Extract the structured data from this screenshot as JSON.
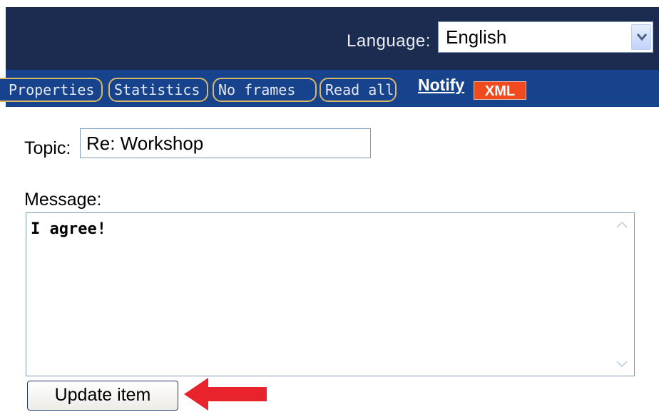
{
  "header": {
    "language_label": "Language:",
    "language_value": "English"
  },
  "nav": {
    "tabs": [
      {
        "label": "Properties"
      },
      {
        "label": "Statistics"
      },
      {
        "label": "No frames"
      },
      {
        "label": "Read all"
      }
    ],
    "notify_label": "Notify",
    "xml_badge": "XML"
  },
  "form": {
    "topic_label": "Topic:",
    "topic_value": "Re: Workshop",
    "message_label": "Message:",
    "message_value": "I agree!",
    "submit_label": "Update item"
  },
  "colors": {
    "header_bg": "#1c2c50",
    "navbar_bg": "#17438c",
    "tab_border": "#d9b86a",
    "xml_badge_bg": "#f04a1e",
    "annotation_arrow": "#e8232b"
  },
  "icons": {
    "dropdown": "chevron-down-icon",
    "annotation": "red-arrow-icon"
  }
}
